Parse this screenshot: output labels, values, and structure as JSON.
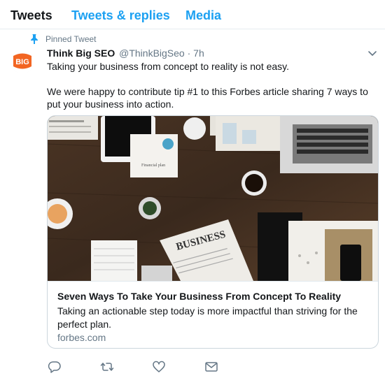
{
  "tabs": [
    {
      "label": "Tweets"
    },
    {
      "label": "Tweets & replies"
    },
    {
      "label": "Media"
    }
  ],
  "pinned_label": "Pinned Tweet",
  "tweet": {
    "avatar_text": "BIG",
    "name": "Think Big SEO",
    "handle": "@ThinkBigSeo",
    "separator": "·",
    "time": "7h",
    "paragraphs": [
      "Taking your business from concept to reality is not easy.",
      "We were happy to contribute tip #1 to this Forbes article sharing 7 ways to put your business into action."
    ]
  },
  "card": {
    "image_words": [
      "BUSINESS",
      "Financial plan"
    ],
    "title": "Seven Ways To Take Your Business From Concept To Reality",
    "description": "Taking an actionable step today is more impactful than striving for the perfect plan.",
    "domain": "forbes.com"
  },
  "icons": {
    "pin": "pin-icon",
    "caret": "chevron-down-icon",
    "reply": "reply-icon",
    "retweet": "retweet-icon",
    "like": "heart-icon",
    "dm": "envelope-icon"
  },
  "colors": {
    "accent": "#1da1f2",
    "secondary_text": "#657786",
    "border": "#e6ecf0",
    "avatar_orange": "#f26522"
  }
}
